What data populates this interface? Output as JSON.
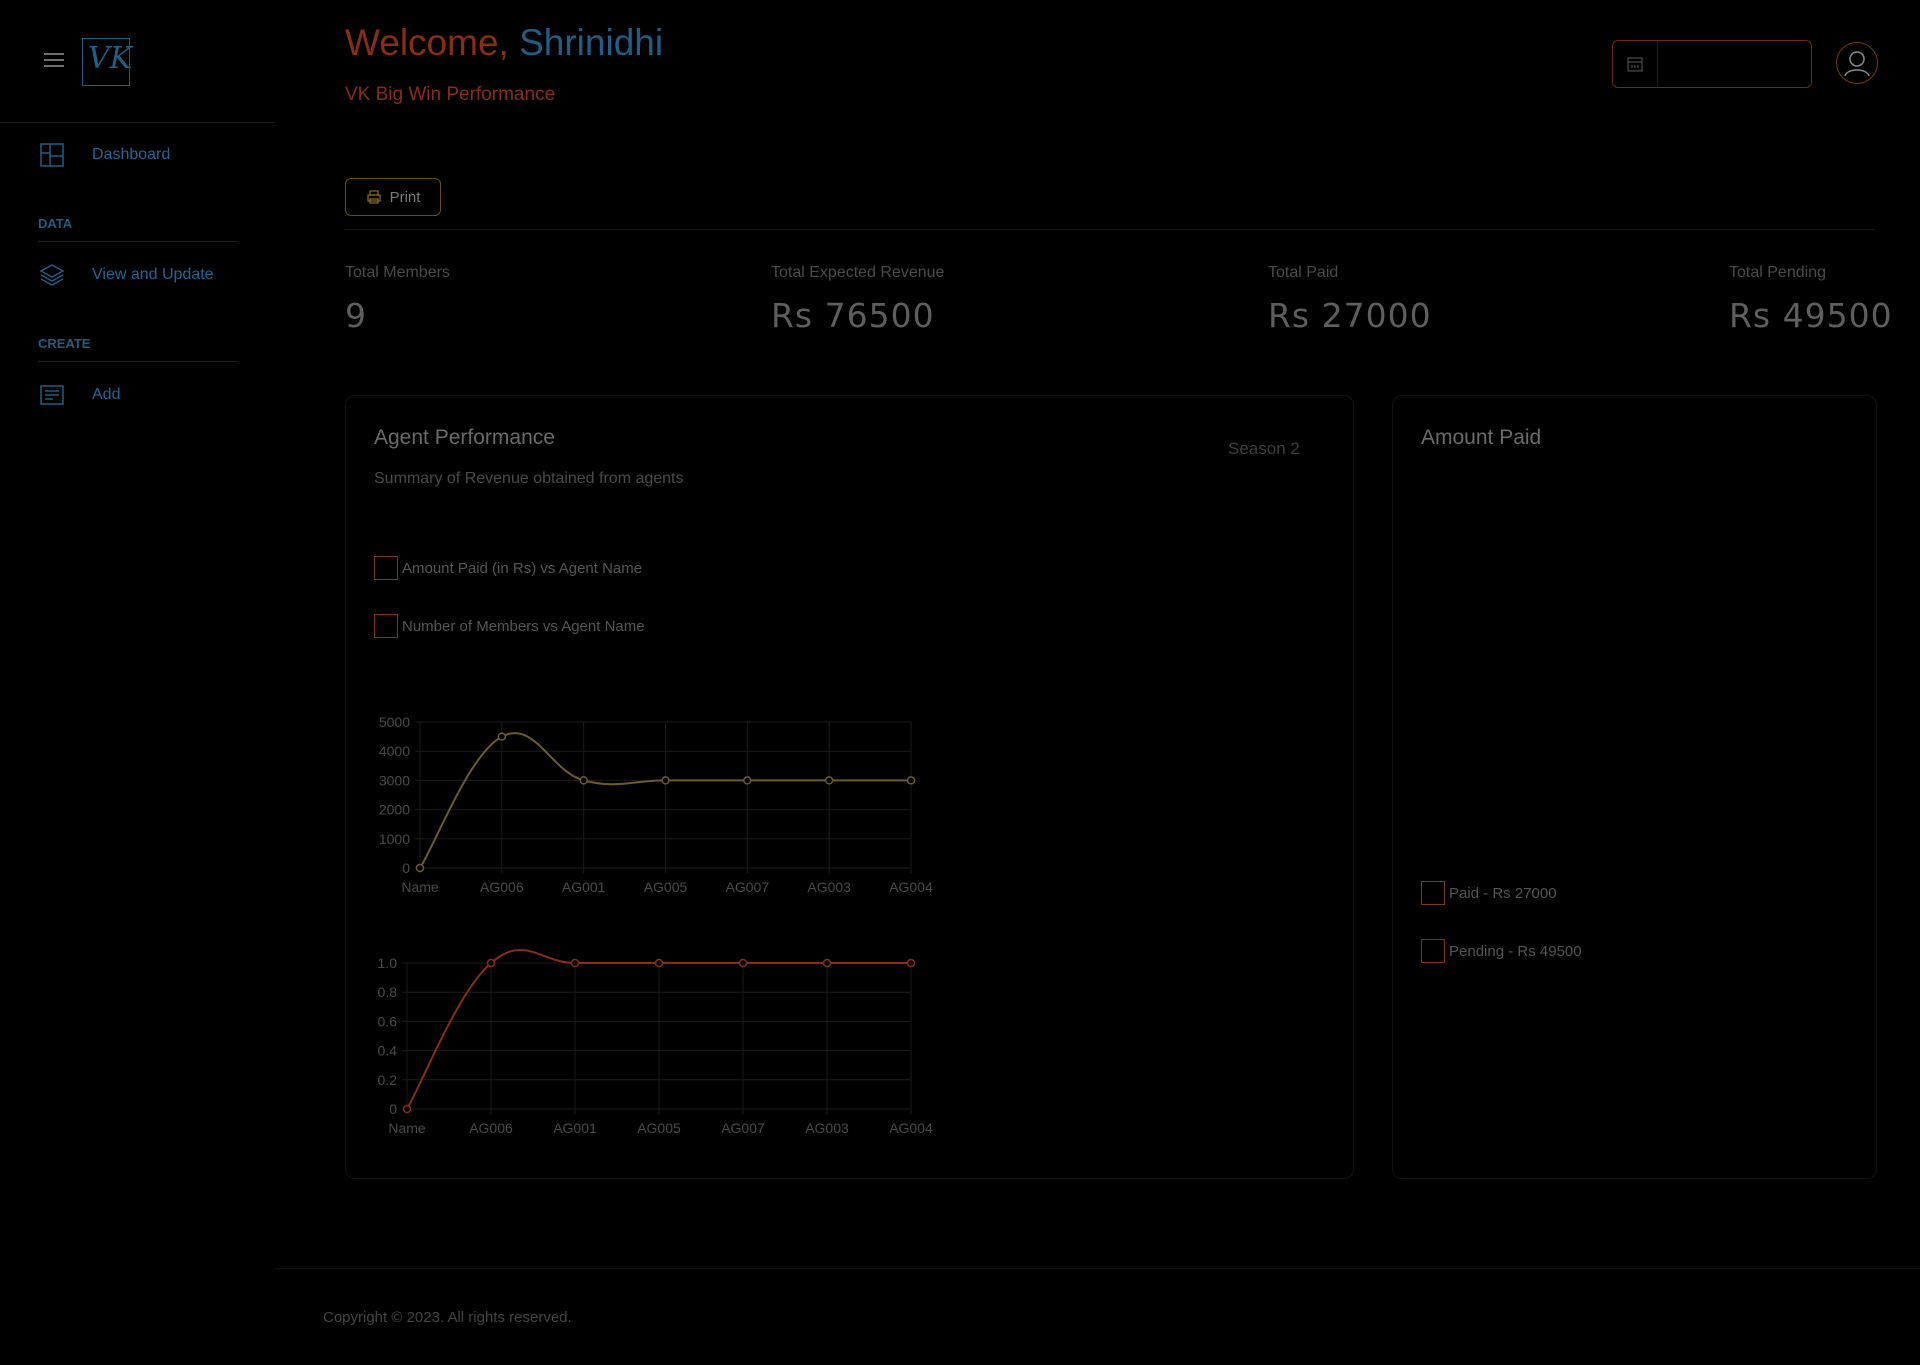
{
  "header": {
    "welcome_prefix": "Welcome,",
    "user_name": "Shrinidhi",
    "subtitle": "VK Big Win Performance",
    "date_value": ""
  },
  "sidebar": {
    "logo_text": "VK",
    "items": [
      {
        "label": "Dashboard",
        "icon": "dashboard-grid-icon"
      },
      {
        "section": "DATA"
      },
      {
        "label": "View and Update",
        "icon": "layers-icon"
      },
      {
        "section": "CREATE"
      },
      {
        "label": "Add",
        "icon": "form-icon"
      }
    ]
  },
  "toolbar": {
    "print_label": "Print"
  },
  "stats": [
    {
      "label": "Total Members",
      "value": "9"
    },
    {
      "label": "Total Expected Revenue",
      "value": "Rs 76500"
    },
    {
      "label": "Total Paid",
      "value": "Rs 27000"
    },
    {
      "label": "Total Pending",
      "value": "Rs 49500"
    }
  ],
  "agent_card": {
    "title": "Agent Performance",
    "subtitle": "Summary of Revenue obtained from agents",
    "season": "Season 2",
    "legend": [
      {
        "label": "Amount Paid (in Rs) vs Agent Name",
        "color": "#7a3a1a"
      },
      {
        "label": "Number of Members vs Agent Name",
        "color": "#8a2d12"
      }
    ]
  },
  "amount_card": {
    "title": "Amount Paid",
    "legend": [
      {
        "label": "Paid - Rs 27000",
        "color": "#7a3a1a"
      },
      {
        "label": "Pending - Rs 49500",
        "color": "#8a2d12"
      }
    ]
  },
  "chart_data": [
    {
      "type": "line",
      "categories": [
        "Name",
        "AG006",
        "AG001",
        "AG005",
        "AG007",
        "AG003",
        "AG004"
      ],
      "series": [
        {
          "values": [
            0,
            4500,
            3000,
            3000,
            3000,
            3000,
            3000
          ],
          "color": "#6f5a2a"
        }
      ],
      "yticks": [
        0,
        1000,
        2000,
        3000,
        4000,
        5000
      ],
      "ylim": [
        0,
        5000
      ],
      "grid": true
    },
    {
      "type": "line",
      "categories": [
        "Name",
        "AG006",
        "AG001",
        "AG005",
        "AG007",
        "AG003",
        "AG004"
      ],
      "series": [
        {
          "values": [
            0,
            1,
            1,
            1,
            1,
            1,
            1
          ],
          "color": "#8a2d12"
        }
      ],
      "yticks": [
        "0",
        "0.2",
        "0.4",
        "0.6",
        "0.8",
        "1.0"
      ],
      "ylim": [
        0,
        1
      ],
      "grid": true
    }
  ],
  "footer": {
    "copyright": "Copyright © 2023. All rights reserved."
  }
}
